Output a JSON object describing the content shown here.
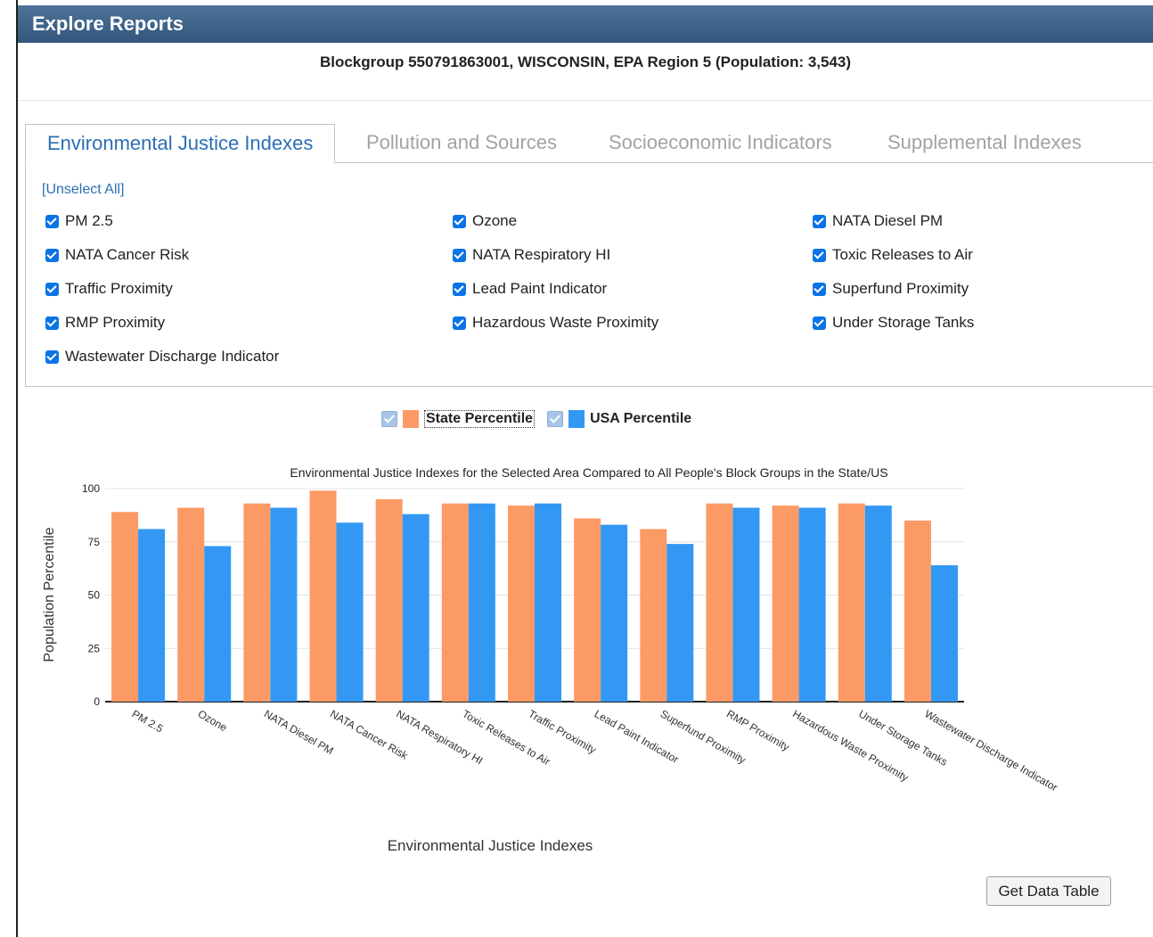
{
  "window": {
    "title": "Explore Reports"
  },
  "location": {
    "heading": "Blockgroup 550791863001, WISCONSIN, EPA Region 5 (Population: 3,543)"
  },
  "tabs": [
    {
      "label": "Environmental Justice Indexes",
      "active": true
    },
    {
      "label": "Pollution and Sources",
      "active": false
    },
    {
      "label": "Socioeconomic Indicators",
      "active": false
    },
    {
      "label": "Supplemental Indexes",
      "active": false
    }
  ],
  "selection": {
    "unselect_all_open": "[",
    "unselect_all_label": "Unselect All",
    "unselect_all_close": "]",
    "checkboxes": [
      {
        "label": "PM 2.5",
        "checked": true
      },
      {
        "label": "Ozone",
        "checked": true
      },
      {
        "label": "NATA Diesel PM",
        "checked": true
      },
      {
        "label": "NATA Cancer Risk",
        "checked": true
      },
      {
        "label": "NATA Respiratory HI",
        "checked": true
      },
      {
        "label": "Toxic Releases to Air",
        "checked": true
      },
      {
        "label": "Traffic Proximity",
        "checked": true
      },
      {
        "label": "Lead Paint Indicator",
        "checked": true
      },
      {
        "label": "Superfund Proximity",
        "checked": true
      },
      {
        "label": "RMP Proximity",
        "checked": true
      },
      {
        "label": "Hazardous Waste Proximity",
        "checked": true
      },
      {
        "label": "Under Storage Tanks",
        "checked": true
      },
      {
        "label": "Wastewater Discharge Indicator",
        "checked": true
      }
    ]
  },
  "legend": {
    "state_label": "State Percentile",
    "usa_label": "USA Percentile"
  },
  "colors": {
    "state": "#fc9a66",
    "usa": "#3298f4",
    "accent": "#2b6fb5",
    "titlebar": "#3f6690"
  },
  "chart_data": {
    "type": "bar",
    "title": "Environmental Justice Indexes for the Selected Area Compared to All People's Block Groups in the State/US",
    "xlabel": "Environmental Justice Indexes",
    "ylabel": "Population Percentile",
    "ylim": [
      0,
      100
    ],
    "yticks": [
      "0",
      "25",
      "50",
      "75",
      "100"
    ],
    "grid": true,
    "categories": [
      "PM 2.5",
      "Ozone",
      "NATA Diesel PM",
      "NATA Cancer Risk",
      "NATA Respiratory HI",
      "Toxic Releases to Air",
      "Traffic Proximity",
      "Lead Paint Indicator",
      "Superfund Proximity",
      "RMP Proximity",
      "Hazardous Waste Proximity",
      "Under Storage Tanks",
      "Wastewater Discharge Indicator"
    ],
    "series": [
      {
        "name": "State Percentile",
        "values": [
          89,
          91,
          93,
          99,
          95,
          93,
          92,
          86,
          81,
          93,
          92,
          93,
          85
        ]
      },
      {
        "name": "USA Percentile",
        "values": [
          81,
          73,
          91,
          84,
          88,
          93,
          93,
          83,
          74,
          91,
          91,
          92,
          64
        ]
      }
    ]
  },
  "actions": {
    "get_data_table": "Get Data Table"
  }
}
